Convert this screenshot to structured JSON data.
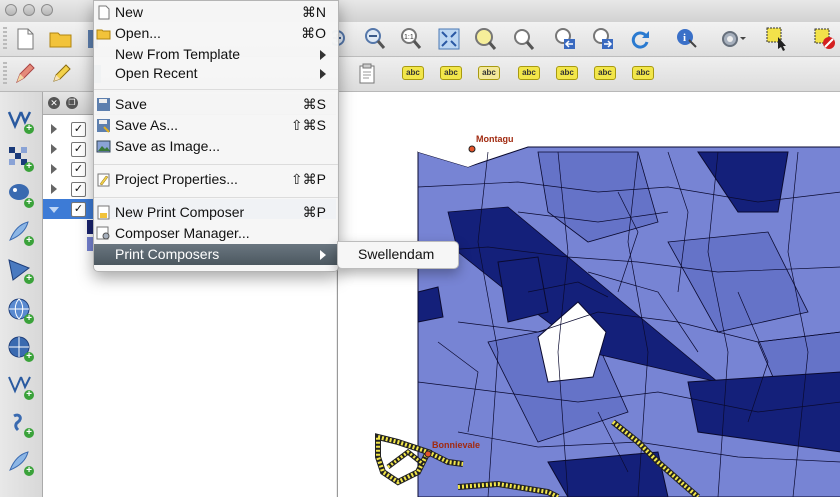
{
  "file_menu": {
    "new": {
      "label": "New",
      "shortcut": "⌘N"
    },
    "open": {
      "label": "Open...",
      "shortcut": "⌘O"
    },
    "new_from_template": {
      "label": "New From Template"
    },
    "open_recent": {
      "label": "Open Recent"
    },
    "save": {
      "label": "Save",
      "shortcut": "⌘S"
    },
    "save_as": {
      "label": "Save As...",
      "shortcut": "⇧⌘S"
    },
    "save_as_image": {
      "label": "Save as Image..."
    },
    "project_properties": {
      "label": "Project Properties...",
      "shortcut": "⇧⌘P"
    },
    "new_print_composer": {
      "label": "New Print Composer",
      "shortcut": "⌘P"
    },
    "composer_manager": {
      "label": "Composer Manager..."
    },
    "print_composers": {
      "label": "Print Composers"
    }
  },
  "print_composers_submenu": {
    "items": [
      "Swellendam"
    ]
  },
  "map": {
    "labels": [
      "Montagu",
      "Bonnievale"
    ],
    "colors": {
      "parcel_light": "#7784d4",
      "parcel_mid": "#5a66c0",
      "parcel_dark": "#14207a",
      "road": "#f2e64a",
      "farm": "#b7b9a3"
    }
  },
  "icons": [
    "new-project-icon",
    "open-project-icon",
    "zoom-in-icon",
    "zoom-out-icon",
    "zoom-native-icon",
    "zoom-full-icon",
    "zoom-layer-icon",
    "zoom-selection-icon",
    "zoom-last-icon",
    "zoom-next-icon",
    "refresh-icon",
    "identify-icon",
    "select-icon",
    "deselect-icon",
    "digitize-icon",
    "edit-pencil-icon",
    "project-properties-icon",
    "label-tool-icons"
  ]
}
